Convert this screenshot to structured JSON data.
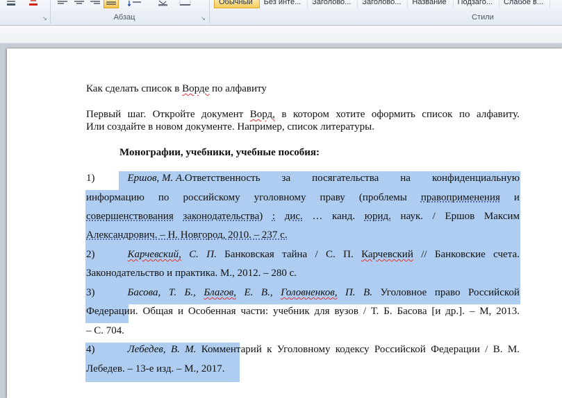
{
  "ribbon": {
    "paragraph_group_label": "Абзац",
    "styles_group_label": "Стили",
    "styles_gallery": [
      "Обычный",
      "Без инте...",
      "Заголово...",
      "Заголово...",
      "Название",
      "Подзаго...",
      "Слабое в..."
    ],
    "active_style": "Обычный",
    "icons": [
      "text-highlight-icon",
      "font-color-icon",
      "align-left-icon",
      "align-center-icon",
      "align-right-icon",
      "justify-icon",
      "line-spacing-icon",
      "shading-icon",
      "borders-icon"
    ],
    "accent_color": "#f9cd5b"
  },
  "document": {
    "title": {
      "a": "Как сделать список в ",
      "b": "Ворде",
      "c": " по алфавиту"
    },
    "intro": {
      "l1": [
        "Первый",
        "шаг.",
        "Откройте",
        "документ",
        "Ворд,",
        "в",
        "котором",
        "хотите",
        "оформить",
        "список",
        "по",
        "алфавиту."
      ],
      "l2": "Или создайте в новом документе. Например, список литературы."
    },
    "heading": "Монографии, учебники, учебные пособия:",
    "selection_color": "#aecdf0",
    "entries": [
      {
        "num": "1)",
        "l1": [
          "Ершов,",
          "М.",
          "А.",
          "Ответственность",
          "за",
          "посягательства",
          "на",
          "конфиденциальную"
        ],
        "l2": [
          "информацию",
          "по",
          "российскому",
          "уголовному",
          "праву",
          "(проблемы",
          "правоприменения",
          "и"
        ],
        "l3": [
          "совершенствования",
          "законодательства)",
          ":",
          "дис.",
          "…",
          "канд.",
          "юрид.",
          "наук.",
          "/",
          "Ершов",
          "Максим"
        ],
        "l4": "Александрович. – Н. Новгород, 2010. – 237 с."
      },
      {
        "num": "2)",
        "l1": [
          "Карчевский,",
          "С.",
          "П.",
          "Банковская",
          "тайна",
          "/",
          "С.",
          "П.",
          "Карчевский",
          "//",
          "Банковские",
          "счета."
        ],
        "l2": "Законодательство и практика. М., 2012. – 280 с."
      },
      {
        "num": "3)",
        "l1": [
          "Басова,",
          "Т.",
          "Б.,",
          "Благов,",
          "Е.",
          "В.,",
          "Головненков,",
          "П.",
          "В.",
          "Уголовное",
          "право",
          "Российской"
        ],
        "l2": [
          "Федерации.",
          "Общая",
          "и",
          "Особенная",
          "части:",
          "учебник",
          "для",
          "вузов",
          "/",
          "Т.",
          "Б.",
          "Басова",
          "[и",
          "др.].",
          "–",
          "М,",
          "2013."
        ],
        "l3": "– С. 704."
      },
      {
        "num": "4)",
        "l1": [
          "Лебедев,",
          "В.",
          "М.",
          "Комментарий",
          "к",
          "Уголовному",
          "кодексу",
          "Российской",
          "Федерации",
          "/",
          "В.",
          "М."
        ],
        "l2": "Лебедев. – 13-е изд. – М., 2017."
      }
    ]
  }
}
